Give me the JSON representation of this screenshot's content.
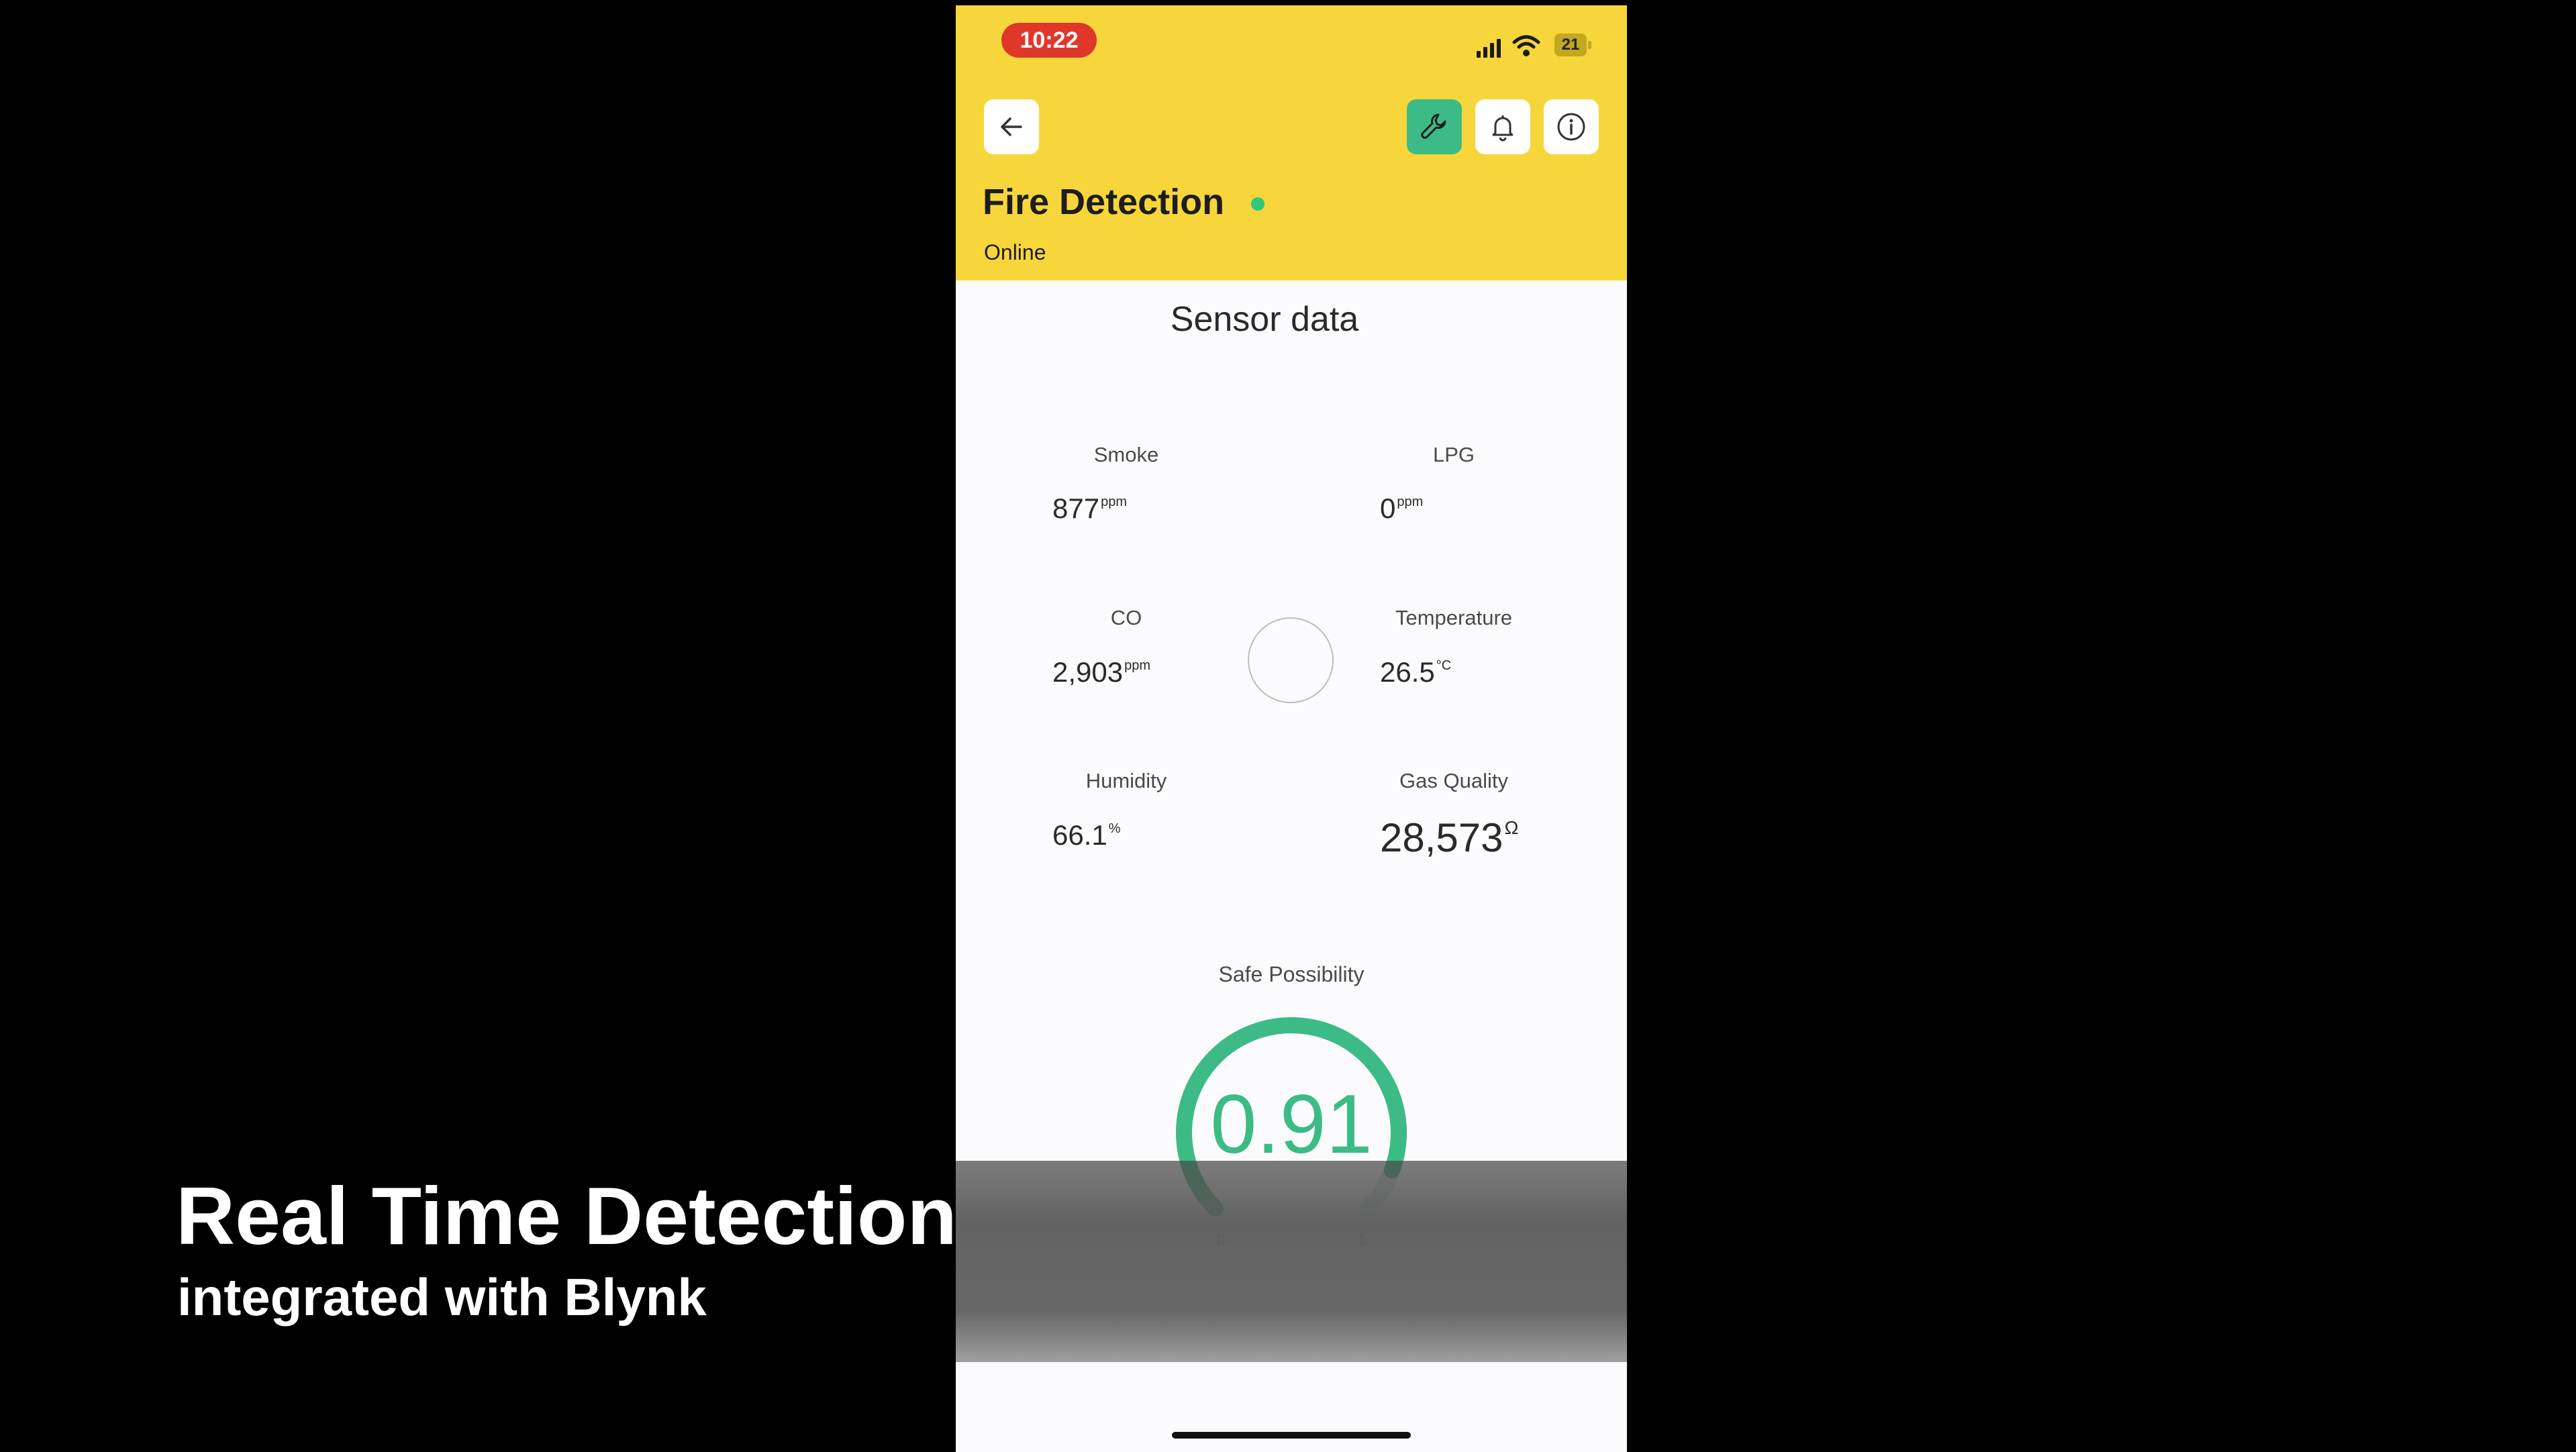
{
  "status_bar": {
    "time": "10:22",
    "battery": "21"
  },
  "header": {
    "title": "Fire Detection",
    "status": "Online",
    "online_color": "#2ec97d",
    "background_color": "#f7d63b",
    "settings_color": "#3dbb86",
    "icons": [
      "back-arrow-icon",
      "wrench-icon",
      "bell-icon",
      "info-icon"
    ]
  },
  "main": {
    "section_title": "Sensor data",
    "metrics": {
      "smoke": {
        "label": "Smoke",
        "value": "877",
        "unit": "ppm"
      },
      "lpg": {
        "label": "LPG",
        "value": "0",
        "unit": "ppm"
      },
      "co": {
        "label": "CO",
        "value": "2,903",
        "unit": "ppm"
      },
      "temperature": {
        "label": "Temperature",
        "value": "26.5",
        "unit": "°C"
      },
      "humidity": {
        "label": "Humidity",
        "value": "66.1",
        "unit": "%"
      },
      "gas_quality": {
        "label": "Gas Quality",
        "value": "28,573",
        "unit": "Ω"
      }
    },
    "gauge": {
      "label": "Safe Possibility",
      "value": "0.91",
      "min": "0",
      "max": "1",
      "fraction": 0.91,
      "color": "#3dbb86"
    }
  },
  "caption": {
    "title": "Real Time Detection",
    "subtitle": "integrated with Blynk"
  }
}
